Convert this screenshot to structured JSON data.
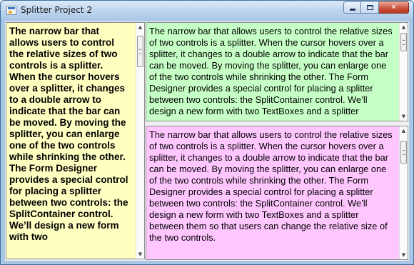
{
  "window": {
    "title": "Splitter Project 2",
    "icon": "form-app-icon",
    "minimize_icon": "minimize-icon",
    "maximize_icon": "maximize-icon",
    "close_glyph": "✕"
  },
  "colors": {
    "left_pane": "#ffffc2",
    "top_right_pane": "#c6ffc6",
    "bottom_right_pane": "#ffc6ff"
  },
  "panes": {
    "left": {
      "text": "The narrow bar that allows users to control the relative sizes of two controls is a splitter. When the cursor hovers over a splitter, it changes to a double arrow to indicate that the bar can be moved. By moving the splitter, you can enlarge one of the two controls while shrinking the other. The Form Designer provides a special control for placing a splitter between two controls: the SplitContainer control. We’ll design a new form with two"
    },
    "top_right": {
      "text": "The narrow bar that allows users to control the relative sizes of two controls is a splitter. When the cursor hovers over a splitter, it changes to a double arrow to indicate that the bar can be moved. By moving the splitter, you can enlarge one of the two controls while shrinking the other. The Form Designer provides a special control for placing a splitter between two controls: the SplitContainer control. We’ll design a new form with two TextBoxes and a splitter"
    },
    "bottom_right": {
      "text": "The narrow bar that allows users to control the relative sizes of two controls is a splitter. When the cursor hovers over a splitter, it changes to a double arrow to indicate that the bar can be moved. By moving the splitter, you can enlarge one of the two controls while shrinking the other. The Form Designer provides a special control for placing a splitter between two controls: the SplitContainer control. We’ll design a new form with two TextBoxes and a splitter between them so that users can change the relative size of the two controls."
    }
  },
  "scroll": {
    "up_glyph": "▲",
    "down_glyph": "▼"
  }
}
